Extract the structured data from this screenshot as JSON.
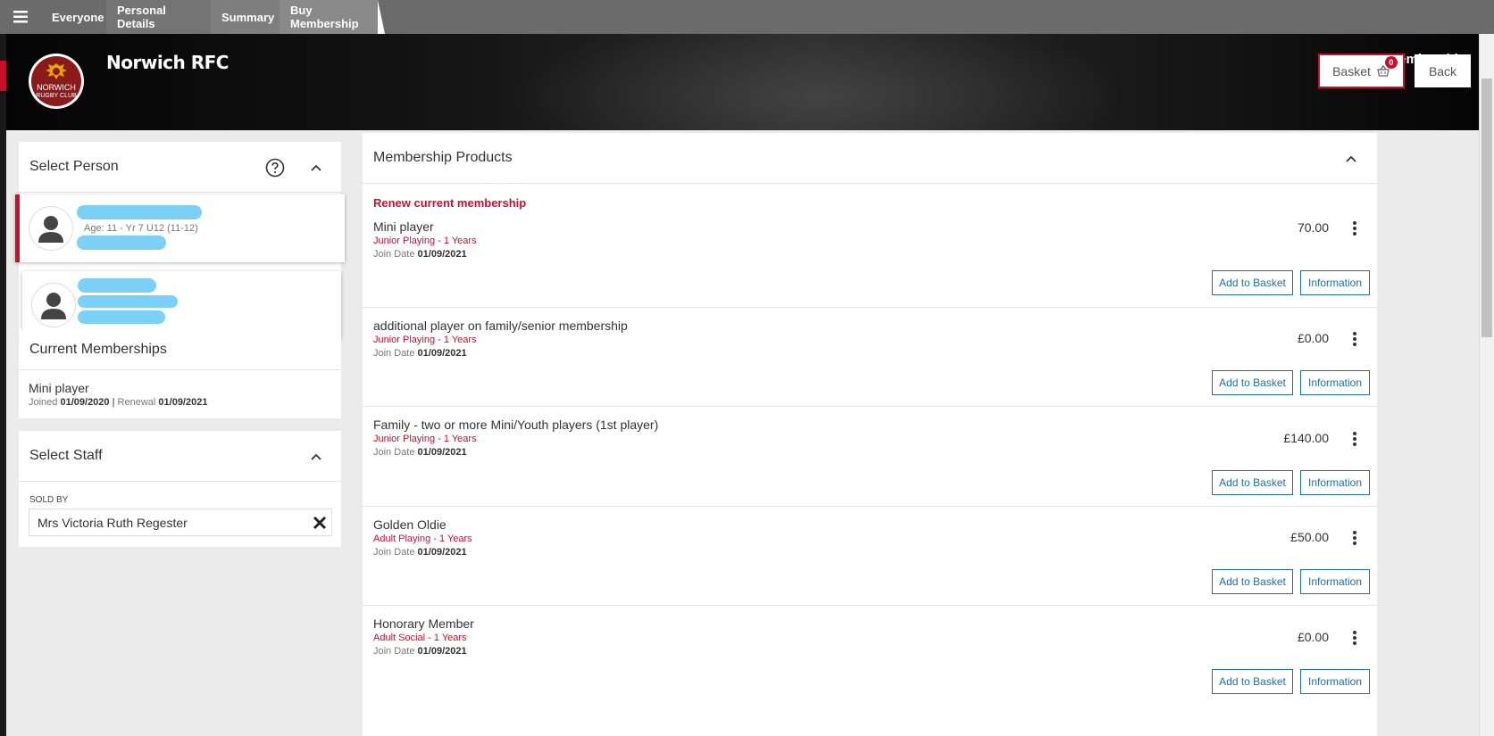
{
  "nav": {
    "crumbs": [
      "Everyone",
      "Personal Details",
      "Summary",
      "Buy Membership"
    ]
  },
  "header": {
    "club_name": "Norwich RFC",
    "logo_text_top": "NORWICH",
    "logo_text_bottom": "RUGBY CLUB",
    "page_title": "Buy Membership",
    "basket_label": "Basket",
    "basket_count": "0",
    "back_label": "Back"
  },
  "select_person": {
    "title": "Select Person",
    "people": [
      {
        "age_line": "Age: 11 - Yr 7 U12 (11-12)",
        "active": true
      },
      {
        "age_line": "",
        "active": false
      }
    ]
  },
  "current_memberships": {
    "title": "Current Memberships",
    "items": [
      {
        "name": "Mini player",
        "joined_label": "Joined",
        "joined": "01/09/2020",
        "separator": "|",
        "renewal_label": "Renewal",
        "renewal": "01/09/2021"
      }
    ]
  },
  "select_staff": {
    "title": "Select Staff",
    "sold_by_label": "SOLD BY",
    "sold_by_value": "Mrs Victoria Ruth Regester"
  },
  "products": {
    "title": "Membership Products",
    "renew_label": "Renew current membership",
    "join_label": "Join Date",
    "add_label": "Add to Basket",
    "info_label": "Information",
    "items": [
      {
        "name": "Mini player",
        "type": "Junior Playing - 1 Years",
        "join_date": "01/09/2021",
        "price": "70.00"
      },
      {
        "name": "additional player on family/senior membership",
        "type": "Junior Playing - 1 Years",
        "join_date": "01/09/2021",
        "price": "£0.00"
      },
      {
        "name": "Family - two or more Mini/Youth players (1st player)",
        "type": "Junior Playing - 1 Years",
        "join_date": "01/09/2021",
        "price": "£140.00"
      },
      {
        "name": "Golden Oldie",
        "type": "Adult Playing - 1 Years",
        "join_date": "01/09/2021",
        "price": "£50.00"
      },
      {
        "name": "Honorary Member",
        "type": "Adult Social - 1 Years",
        "join_date": "01/09/2021",
        "price": "£0.00"
      }
    ]
  },
  "colors": {
    "accent_red": "#c8102e",
    "link_blue": "#1e6fa8",
    "redaction": "#7ccff5"
  }
}
